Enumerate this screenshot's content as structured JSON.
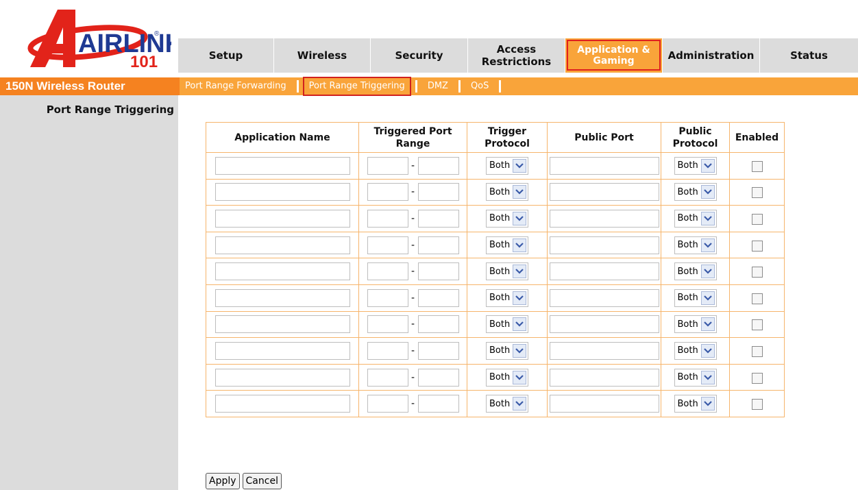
{
  "brand": {
    "logo_text": "AIRLINK",
    "logo_number": "101",
    "colors": {
      "red": "#e2231a",
      "blue": "#1f3a93",
      "orange_dark": "#f58220",
      "orange_light": "#f9a43a"
    }
  },
  "topnav": {
    "tabs": [
      {
        "label": "Setup"
      },
      {
        "label": "Wireless"
      },
      {
        "label": "Security"
      },
      {
        "label": "Access Restrictions"
      },
      {
        "label": "Application & Gaming",
        "active": true
      },
      {
        "label": "Administration"
      },
      {
        "label": "Status"
      }
    ]
  },
  "subbar": {
    "router_title": "150N Wireless Router",
    "links": [
      {
        "label": "Port Range Forwarding"
      },
      {
        "label": "Port Range Triggering",
        "active": true
      },
      {
        "label": "DMZ"
      },
      {
        "label": "QoS"
      }
    ]
  },
  "page": {
    "section_title": "Port Range Triggering"
  },
  "table": {
    "headers": {
      "app_name": "Application Name",
      "triggered_port_range": "Triggered Port Range",
      "trigger_protocol": "Trigger Protocol",
      "public_port": "Public Port",
      "public_protocol": "Public Protocol",
      "enabled": "Enabled"
    },
    "dash": "-",
    "rows": [
      {
        "app_name": "",
        "trigger_start": "",
        "trigger_end": "",
        "trigger_protocol": "Both",
        "public_port": "",
        "public_protocol": "Both",
        "enabled": false
      },
      {
        "app_name": "",
        "trigger_start": "",
        "trigger_end": "",
        "trigger_protocol": "Both",
        "public_port": "",
        "public_protocol": "Both",
        "enabled": false
      },
      {
        "app_name": "",
        "trigger_start": "",
        "trigger_end": "",
        "trigger_protocol": "Both",
        "public_port": "",
        "public_protocol": "Both",
        "enabled": false
      },
      {
        "app_name": "",
        "trigger_start": "",
        "trigger_end": "",
        "trigger_protocol": "Both",
        "public_port": "",
        "public_protocol": "Both",
        "enabled": false
      },
      {
        "app_name": "",
        "trigger_start": "",
        "trigger_end": "",
        "trigger_protocol": "Both",
        "public_port": "",
        "public_protocol": "Both",
        "enabled": false
      },
      {
        "app_name": "",
        "trigger_start": "",
        "trigger_end": "",
        "trigger_protocol": "Both",
        "public_port": "",
        "public_protocol": "Both",
        "enabled": false
      },
      {
        "app_name": "",
        "trigger_start": "",
        "trigger_end": "",
        "trigger_protocol": "Both",
        "public_port": "",
        "public_protocol": "Both",
        "enabled": false
      },
      {
        "app_name": "",
        "trigger_start": "",
        "trigger_end": "",
        "trigger_protocol": "Both",
        "public_port": "",
        "public_protocol": "Both",
        "enabled": false
      },
      {
        "app_name": "",
        "trigger_start": "",
        "trigger_end": "",
        "trigger_protocol": "Both",
        "public_port": "",
        "public_protocol": "Both",
        "enabled": false
      },
      {
        "app_name": "",
        "trigger_start": "",
        "trigger_end": "",
        "trigger_protocol": "Both",
        "public_port": "",
        "public_protocol": "Both",
        "enabled": false
      }
    ]
  },
  "buttons": {
    "apply": "Apply",
    "cancel": "Cancel"
  }
}
